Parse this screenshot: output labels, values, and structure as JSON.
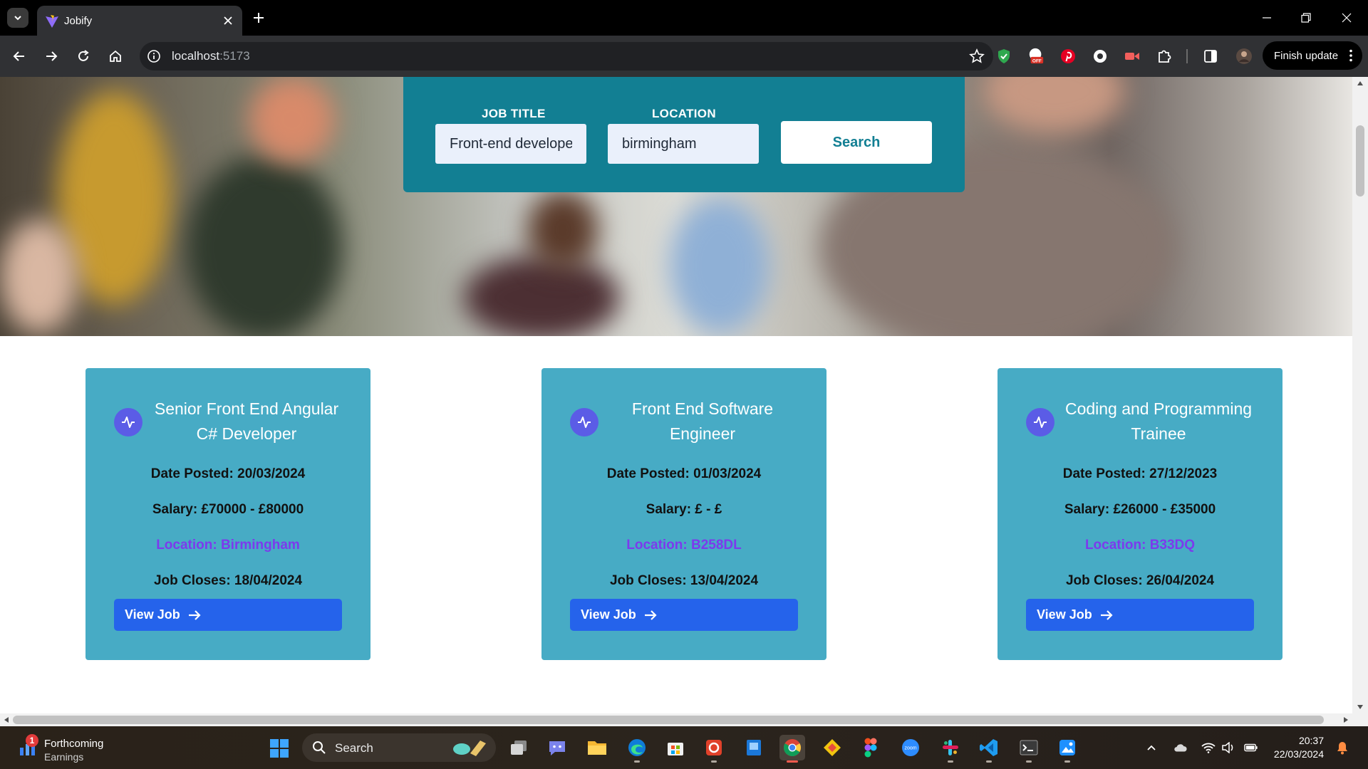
{
  "browser": {
    "tab_title": "Jobify",
    "url_host": "localhost",
    "url_port": ":5173",
    "finish_update_label": "Finish update"
  },
  "search": {
    "job_title_label": "JOB TITLE",
    "job_title_value": "Front-end developer",
    "location_label": "LOCATION",
    "location_value": "birmingham",
    "search_button": "Search"
  },
  "jobs": [
    {
      "title": "Senior Front End Angular C# Developer",
      "date_posted": "Date Posted: 20/03/2024",
      "salary": "Salary: £70000 - £80000",
      "location": "Location: Birmingham",
      "closes": "Job Closes: 18/04/2024",
      "button": "View Job"
    },
    {
      "title": "Front End Software Engineer",
      "date_posted": "Date Posted: 01/03/2024",
      "salary": "Salary: £ - £",
      "location": "Location: B258DL",
      "closes": "Job Closes: 13/04/2024",
      "button": "View Job"
    },
    {
      "title": "Coding and Programming Trainee",
      "date_posted": "Date Posted: 27/12/2023",
      "salary": "Salary: £26000 - £35000",
      "location": "Location: B33DQ",
      "closes": "Job Closes: 26/04/2024",
      "button": "View Job"
    }
  ],
  "taskbar": {
    "widget_badge": "1",
    "widget_line1": "Forthcoming",
    "widget_line2": "Earnings",
    "search_label": "Search",
    "time": "20:37",
    "date": "22/03/2024"
  },
  "colors": {
    "search_panel": "#127f93",
    "card_bg": "#47abc5",
    "location_text": "#7c3aed",
    "view_button": "#2563eb",
    "icon_circle": "#5b5ce6"
  },
  "icons": {
    "card_icon": "activity-pulse-icon",
    "view_button_icon": "arrow-right-icon"
  }
}
